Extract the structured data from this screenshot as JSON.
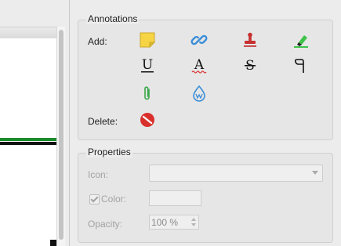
{
  "annotations": {
    "title": "Annotations",
    "add_label": "Add:",
    "delete_label": "Delete:",
    "tools": {
      "note": "sticky-note-icon",
      "link": "link-icon",
      "stamp": "stamp-icon",
      "highlight": "highlighter-icon",
      "underline": "underline-icon",
      "squiggly": "squiggly-underline-icon",
      "strikeout": "strikeout-icon",
      "ink": "freehand-ink-icon",
      "attachment": "paperclip-icon",
      "sound": "drop-icon",
      "delete": "no-entry-icon"
    },
    "glyphs": {
      "underline_letter": "U",
      "squiggly_letter": "A",
      "strikeout_letter": "S"
    }
  },
  "properties": {
    "title": "Properties",
    "icon_label": "Icon:",
    "icon_value": "",
    "color_label": "Color:",
    "color_checked": true,
    "opacity_label": "Opacity:",
    "opacity_value": "100 %"
  },
  "colors": {
    "panel_bg": "#ececec",
    "note_yellow": "#f6d444",
    "link_blue": "#3b8ed8",
    "stamp_red": "#c63030",
    "highlight_green": "#3ec24a",
    "delete_red": "#d9302c",
    "doc_green": "#1b8c2a"
  }
}
